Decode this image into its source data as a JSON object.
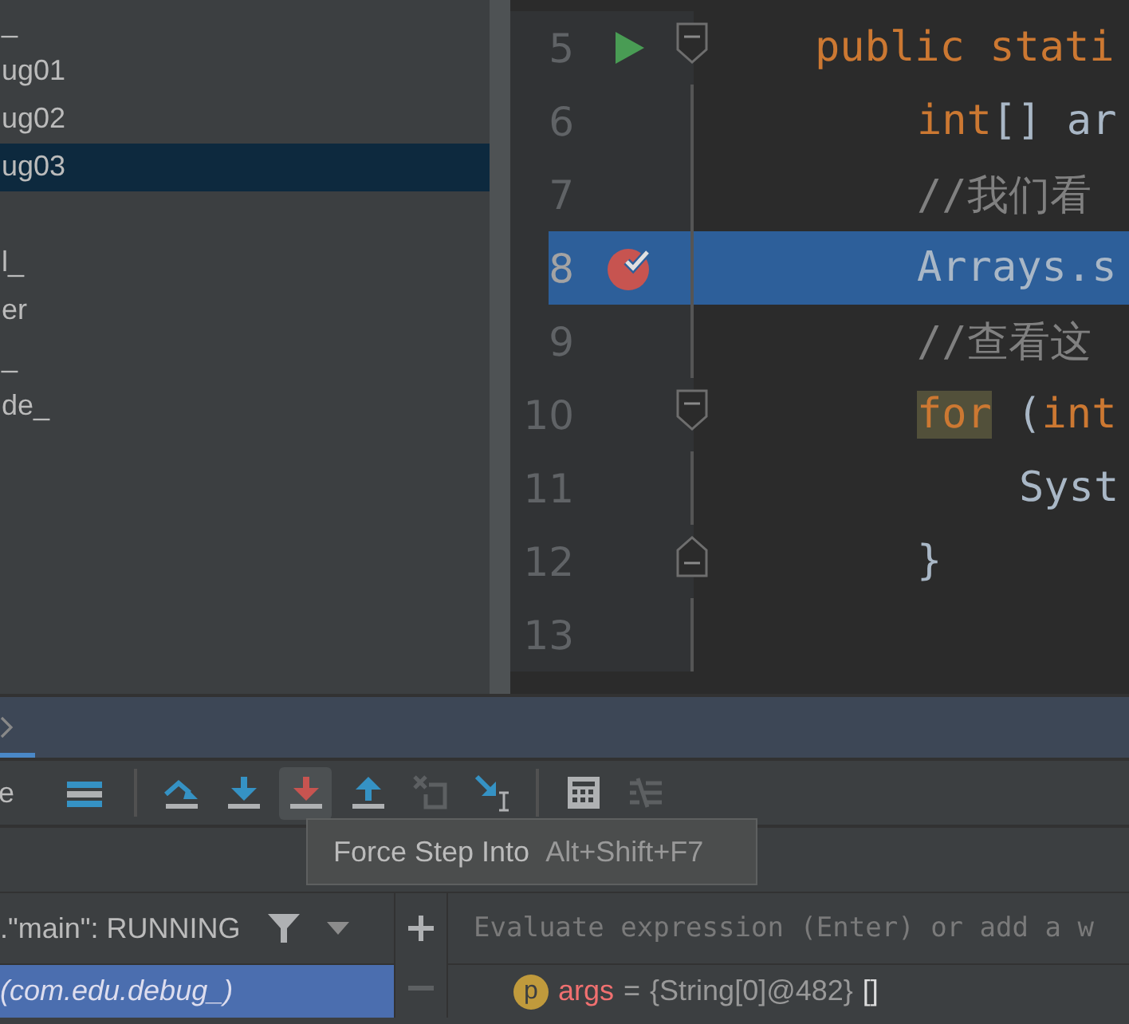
{
  "project_tree": {
    "groups": [
      [
        {
          "label": "_",
          "selected": false
        },
        {
          "label": "ug01",
          "selected": false
        },
        {
          "label": "ug02",
          "selected": false
        },
        {
          "label": "ug03",
          "selected": true
        }
      ],
      [
        {
          "label": "l_",
          "selected": false
        },
        {
          "label": "er",
          "selected": false
        },
        {
          "label": "_",
          "selected": false
        },
        {
          "label": "de_",
          "selected": false
        }
      ]
    ]
  },
  "editor": {
    "lines": [
      {
        "number": "5",
        "runnable": true,
        "fold_start": true,
        "current": false,
        "tokens": [
          {
            "kind": "keyword",
            "text": "public stati"
          }
        ],
        "children": [
          {
            "number": "6",
            "current": false,
            "tokens": [
              {
                "kind": "keyword",
                "text": "int"
              },
              {
                "kind": "plain",
                "text": "[] ar"
              }
            ]
          },
          {
            "number": "7",
            "current": false,
            "tokens": [
              {
                "kind": "comment",
                "text": "//我们看"
              }
            ]
          },
          {
            "number": "8",
            "breakpoint": true,
            "current": true,
            "tokens": [
              {
                "kind": "plain",
                "text": "Arrays.s"
              }
            ]
          },
          {
            "number": "9",
            "current": false,
            "tokens": [
              {
                "kind": "comment",
                "text": "//查看这"
              }
            ]
          },
          {
            "number": "10",
            "fold_start": true,
            "current": false,
            "tokens": [
              {
                "kind": "match",
                "text": "for"
              },
              {
                "kind": "plain",
                "text": " ("
              },
              {
                "kind": "keyword",
                "text": "int"
              }
            ],
            "children": [
              {
                "number": "11",
                "current": false,
                "tokens": [
                  {
                    "kind": "plain",
                    "text": "Syst"
                  }
                ]
              }
            ]
          },
          {
            "number": "12",
            "fold_end": true,
            "current": false,
            "tokens": [
              {
                "kind": "plain",
                "text": "}"
              }
            ]
          }
        ]
      },
      {
        "number": "13",
        "current": false
      }
    ]
  },
  "debug": {
    "toolbar": [
      {
        "kind": "text",
        "text": "e"
      },
      {
        "kind": "lines"
      },
      {
        "kind": "sep"
      },
      {
        "kind": "step-over",
        "hovered": false,
        "disabled": false
      },
      {
        "kind": "step-into",
        "hovered": false,
        "disabled": false
      },
      {
        "kind": "force-step-into",
        "hovered": true,
        "disabled": false
      },
      {
        "kind": "step-out",
        "hovered": false,
        "disabled": false
      },
      {
        "kind": "drop-frame",
        "hovered": false,
        "disabled": true
      },
      {
        "kind": "run-to-cursor",
        "hovered": false,
        "disabled": false
      },
      {
        "kind": "sep"
      },
      {
        "kind": "calculator",
        "hovered": false,
        "disabled": false
      },
      {
        "kind": "trace",
        "hovered": false,
        "disabled": true
      }
    ],
    "tooltip": {
      "title": "Force Step Into",
      "shortcut": "Alt+Shift+F7"
    },
    "threads": {
      "label": ".\"main\": RUNNING"
    },
    "frames": [
      {
        "label": "(com.edu.debug_)",
        "selected": true
      }
    ],
    "evaluate": {
      "placeholder": "Evaluate expression (Enter) or add a w"
    },
    "variables": [
      {
        "badge": "p",
        "name": "args",
        "separator": "=",
        "type": "{String[0]@482}",
        "value": "[]"
      }
    ]
  }
}
